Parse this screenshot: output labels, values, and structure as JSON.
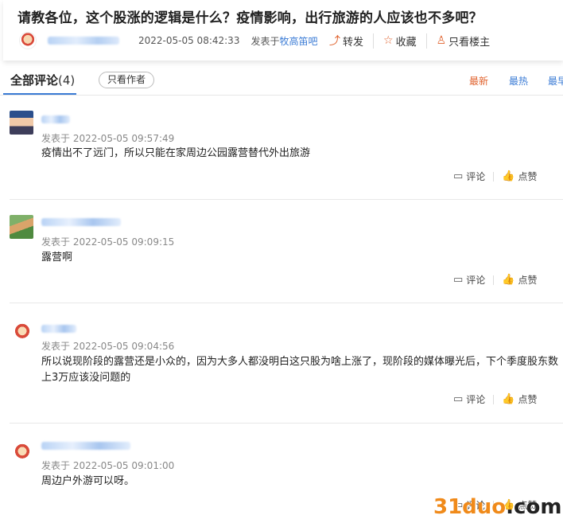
{
  "post": {
    "title": "请教各位，这个股涨的逻辑是什么？疫情影响，出行旅游的人应该也不多吧？",
    "time": "2022-05-05 08:42:33",
    "published_in_prefix": "发表于",
    "forum": "牧高笛吧",
    "actions": {
      "share": "转发",
      "favorite": "收藏",
      "op_only": "只看楼主"
    }
  },
  "tabs": {
    "all_comments_label": "全部评论",
    "all_comments_count": "(4)",
    "op_only_button": "只看作者",
    "sort_newest": "最新",
    "sort_hot": "最热",
    "sort_earliest": "最早"
  },
  "comment_actions": {
    "reply": "评论",
    "like": "点赞"
  },
  "comments": [
    {
      "time": "发表于 2022-05-05 09:57:49",
      "text": "疫情出不了远门，所以只能在家周边公园露营替代外出旅游"
    },
    {
      "time": "发表于 2022-05-05 09:09:15",
      "text": "露营啊"
    },
    {
      "time": "发表于 2022-05-05 09:04:56",
      "text": "所以说现阶段的露营还是小众的，因为大多人都没明白这只股为啥上涨了，现阶段的媒体曝光后，下个季度股东数上3万应该没问题的"
    },
    {
      "time": "发表于 2022-05-05 09:01:00",
      "text": "周边户外游可以呀。"
    }
  ],
  "watermark": {
    "brand": "31duo",
    "suffix": ".com"
  },
  "colors": {
    "accent_blue": "#3a7bd5",
    "accent_orange": "#e0622d"
  }
}
